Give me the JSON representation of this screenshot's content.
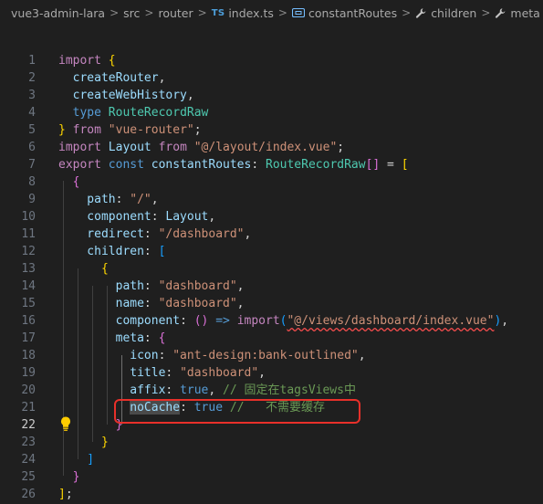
{
  "breadcrumb": {
    "items": [
      {
        "label": "vue3-admin-lara",
        "icon": ""
      },
      {
        "label": "src",
        "icon": ""
      },
      {
        "label": "router",
        "icon": ""
      },
      {
        "label": "index.ts",
        "icon": "TS"
      },
      {
        "label": "constantRoutes",
        "icon": "variable-icon"
      },
      {
        "label": "children",
        "icon": "wrench-icon"
      },
      {
        "label": "meta",
        "icon": "wrench-icon"
      }
    ],
    "separator": ">"
  },
  "editor": {
    "active_line": 22,
    "line_numbers": [
      "1",
      "2",
      "3",
      "4",
      "5",
      "6",
      "7",
      "8",
      "9",
      "10",
      "11",
      "12",
      "13",
      "14",
      "15",
      "16",
      "17",
      "18",
      "19",
      "20",
      "21",
      "22",
      "23",
      "24",
      "25",
      "26"
    ],
    "lines": [
      [
        {
          "t": "import ",
          "c": "c"
        },
        {
          "t": "{",
          "c": "b1"
        }
      ],
      [
        {
          "t": "  createRouter",
          "c": "v"
        },
        {
          "t": ",",
          "c": "p"
        }
      ],
      [
        {
          "t": "  createWebHistory",
          "c": "v"
        },
        {
          "t": ",",
          "c": "p"
        }
      ],
      [
        {
          "t": "  type ",
          "c": "k"
        },
        {
          "t": "RouteRecordRaw",
          "c": "t"
        }
      ],
      [
        {
          "t": "}",
          "c": "b1"
        },
        {
          "t": " from ",
          "c": "c"
        },
        {
          "t": "\"vue-router\"",
          "c": "s"
        },
        {
          "t": ";",
          "c": "p"
        }
      ],
      [
        {
          "t": "import ",
          "c": "c"
        },
        {
          "t": "Layout ",
          "c": "v"
        },
        {
          "t": "from ",
          "c": "c"
        },
        {
          "t": "\"@/layout/index.vue\"",
          "c": "s"
        },
        {
          "t": ";",
          "c": "p"
        }
      ],
      [
        {
          "t": "export ",
          "c": "c"
        },
        {
          "t": "const ",
          "c": "k"
        },
        {
          "t": "constantRoutes",
          "c": "v"
        },
        {
          "t": ": ",
          "c": "p"
        },
        {
          "t": "RouteRecordRaw",
          "c": "t"
        },
        {
          "t": "[]",
          "c": "b2"
        },
        {
          "t": " = ",
          "c": "p"
        },
        {
          "t": "[",
          "c": "b1"
        }
      ],
      [
        {
          "t": "  {",
          "c": "b2"
        }
      ],
      [
        {
          "t": "    path",
          "c": "v"
        },
        {
          "t": ": ",
          "c": "p"
        },
        {
          "t": "\"/\"",
          "c": "s"
        },
        {
          "t": ",",
          "c": "p"
        }
      ],
      [
        {
          "t": "    component",
          "c": "v"
        },
        {
          "t": ": ",
          "c": "p"
        },
        {
          "t": "Layout",
          "c": "v"
        },
        {
          "t": ",",
          "c": "p"
        }
      ],
      [
        {
          "t": "    redirect",
          "c": "v"
        },
        {
          "t": ": ",
          "c": "p"
        },
        {
          "t": "\"/dashboard\"",
          "c": "s"
        },
        {
          "t": ",",
          "c": "p"
        }
      ],
      [
        {
          "t": "    children",
          "c": "v"
        },
        {
          "t": ": ",
          "c": "p"
        },
        {
          "t": "[",
          "c": "b3"
        }
      ],
      [
        {
          "t": "      {",
          "c": "b1"
        }
      ],
      [
        {
          "t": "        path",
          "c": "v"
        },
        {
          "t": ": ",
          "c": "p"
        },
        {
          "t": "\"dashboard\"",
          "c": "s"
        },
        {
          "t": ",",
          "c": "p"
        }
      ],
      [
        {
          "t": "        name",
          "c": "v"
        },
        {
          "t": ": ",
          "c": "p"
        },
        {
          "t": "\"dashboard\"",
          "c": "s"
        },
        {
          "t": ",",
          "c": "p"
        }
      ],
      [
        {
          "t": "        component",
          "c": "v"
        },
        {
          "t": ": ",
          "c": "p"
        },
        {
          "t": "()",
          "c": "b2"
        },
        {
          "t": " => ",
          "c": "k"
        },
        {
          "t": "import",
          "c": "c"
        },
        {
          "t": "(",
          "c": "b3"
        },
        {
          "t": "\"@/views/dashboard/index.vue\"",
          "c": "s sq"
        },
        {
          "t": ")",
          "c": "b3"
        },
        {
          "t": ",",
          "c": "p"
        }
      ],
      [
        {
          "t": "        meta",
          "c": "v"
        },
        {
          "t": ": ",
          "c": "p"
        },
        {
          "t": "{",
          "c": "b2"
        }
      ],
      [
        {
          "t": "          icon",
          "c": "v"
        },
        {
          "t": ": ",
          "c": "p"
        },
        {
          "t": "\"ant-design:bank-outlined\"",
          "c": "s"
        },
        {
          "t": ",",
          "c": "p"
        }
      ],
      [
        {
          "t": "          title",
          "c": "v"
        },
        {
          "t": ": ",
          "c": "p"
        },
        {
          "t": "\"dashboard\"",
          "c": "s"
        },
        {
          "t": ",",
          "c": "p"
        }
      ],
      [
        {
          "t": "          affix",
          "c": "v"
        },
        {
          "t": ": ",
          "c": "p"
        },
        {
          "t": "true",
          "c": "k"
        },
        {
          "t": ", ",
          "c": "p"
        },
        {
          "t": "// 固定在tagsViews中",
          "c": "cm"
        }
      ],
      [
        {
          "t": "          ",
          "c": "p"
        },
        {
          "t": "noCache",
          "c": "v hw"
        },
        {
          "t": ": ",
          "c": "p"
        },
        {
          "t": "true",
          "c": "k"
        },
        {
          "t": " // ",
          "c": "cm"
        },
        {
          "t": "  不需要缓存",
          "c": "cm"
        }
      ],
      [
        {
          "t": "        ",
          "c": "p"
        },
        {
          "t": "}",
          "c": "b2"
        }
      ],
      [
        {
          "t": "      }",
          "c": "b1"
        }
      ],
      [
        {
          "t": "    ]",
          "c": "b3"
        }
      ],
      [
        {
          "t": "  }",
          "c": "b2"
        }
      ],
      [
        {
          "t": "]",
          "c": "b1"
        },
        {
          "t": ";",
          "c": "p"
        }
      ]
    ]
  },
  "colors": {
    "background": "#1f1f1f",
    "annotation_box": "#e8302a",
    "lightbulb": "#ffcc00"
  }
}
